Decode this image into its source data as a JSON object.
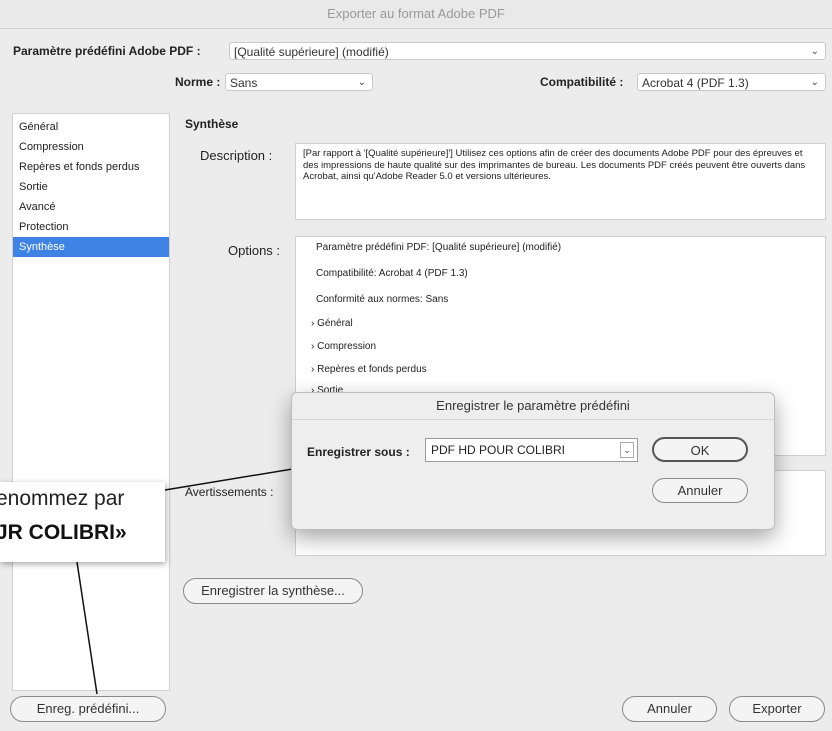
{
  "window": {
    "title": "Exporter au format Adobe PDF"
  },
  "preset": {
    "label": "Paramètre prédéfini Adobe PDF :",
    "value": "[Qualité supérieure] (modifié)"
  },
  "norme": {
    "label": "Norme :",
    "value": "Sans"
  },
  "compat": {
    "label": "Compatibilité :",
    "value": "Acrobat 4 (PDF 1.3)"
  },
  "sidebar": {
    "items": [
      {
        "label": "Général"
      },
      {
        "label": "Compression"
      },
      {
        "label": "Repères et fonds perdus"
      },
      {
        "label": "Sortie"
      },
      {
        "label": "Avancé"
      },
      {
        "label": "Protection"
      },
      {
        "label": "Synthèse"
      }
    ]
  },
  "summary": {
    "heading": "Synthèse",
    "description_label": "Description :",
    "description": "[Par rapport à '[Qualité supérieure]'] Utilisez ces options afin de créer des documents Adobe PDF pour des épreuves et des impressions de haute qualité sur des imprimantes de bureau. Les documents PDF créés peuvent être ouverts dans Acrobat, ainsi qu'Adobe Reader 5.0 et versions ultérieures.",
    "options_label": "Options :",
    "options": [
      "Paramètre prédéfini PDF: [Qualité supérieure] (modifié)",
      "Compatibilité: Acrobat 4 (PDF 1.3)",
      "Conformité aux normes: Sans"
    ],
    "groups": [
      "Général",
      "Compression",
      "Repères et fonds perdus",
      "Sortie"
    ],
    "warnings_label": "Avertissements :"
  },
  "buttons": {
    "save_summary": "Enregistrer la synthèse...",
    "save_preset": "Enreg. prédéfini...",
    "cancel": "Annuler",
    "export": "Exporter"
  },
  "dialog": {
    "title": "Enregistrer le paramètre prédéfini",
    "save_as_label": "Enregistrer sous :",
    "save_as_value": "PDF HD POUR COLIBRI",
    "ok": "OK",
    "cancel": "Annuler"
  },
  "callout": {
    "line1": "enommez par",
    "line2": "JR COLIBRI»"
  }
}
